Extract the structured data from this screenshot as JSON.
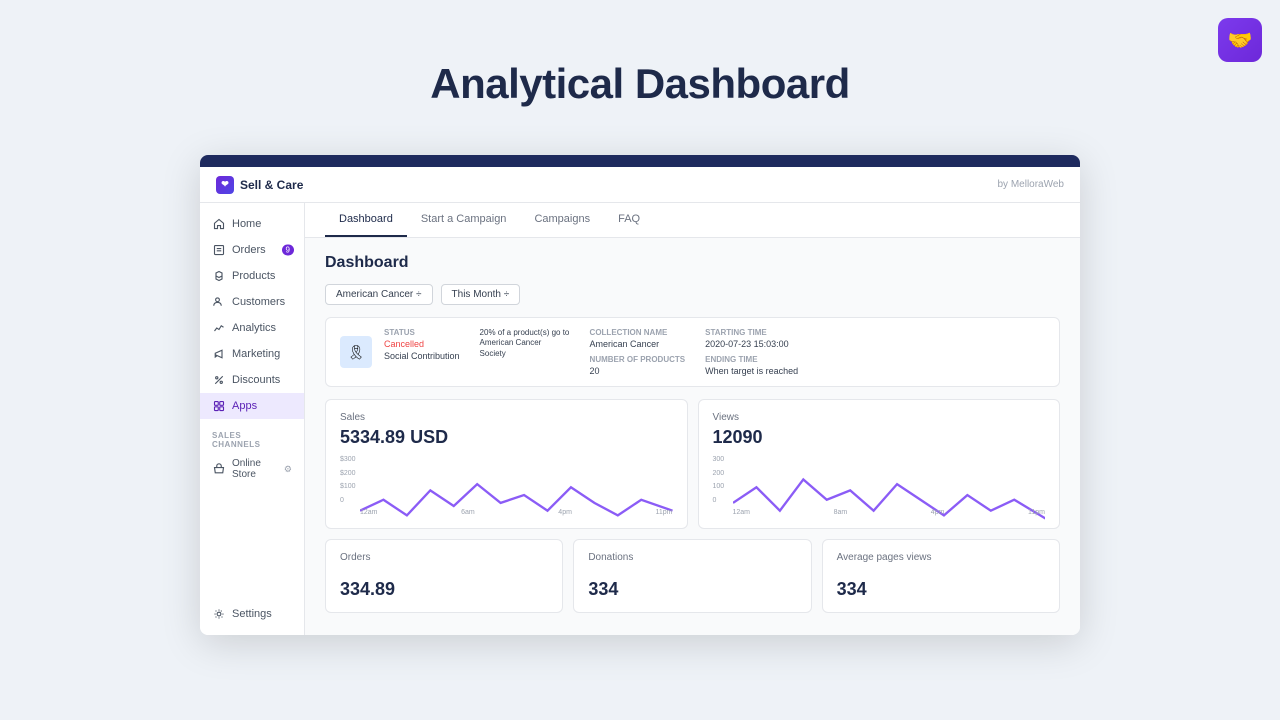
{
  "page": {
    "title": "Analytical Dashboard",
    "logo_symbol": "🤝"
  },
  "app": {
    "brand_name": "Sell & Care",
    "by_text": "by MelloraWeb"
  },
  "sidebar": {
    "nav_items": [
      {
        "id": "home",
        "label": "Home",
        "icon": "home",
        "active": false,
        "badge": null
      },
      {
        "id": "orders",
        "label": "Orders",
        "icon": "orders",
        "active": false,
        "badge": "9"
      },
      {
        "id": "products",
        "label": "Products",
        "icon": "products",
        "active": false,
        "badge": null
      },
      {
        "id": "customers",
        "label": "Customers",
        "icon": "customers",
        "active": false,
        "badge": null
      },
      {
        "id": "analytics",
        "label": "Analytics",
        "icon": "analytics",
        "active": false,
        "badge": null
      },
      {
        "id": "marketing",
        "label": "Marketing",
        "icon": "marketing",
        "active": false,
        "badge": null
      },
      {
        "id": "discounts",
        "label": "Discounts",
        "icon": "discounts",
        "active": false,
        "badge": null
      },
      {
        "id": "apps",
        "label": "Apps",
        "icon": "apps",
        "active": true,
        "badge": null
      }
    ],
    "section_title": "SALES CHANNELS",
    "sub_items": [
      {
        "id": "online-store",
        "label": "Online Store"
      }
    ],
    "bottom_items": [
      {
        "id": "settings",
        "label": "Settings",
        "icon": "settings"
      }
    ]
  },
  "tabs": [
    {
      "id": "dashboard",
      "label": "Dashboard",
      "active": true
    },
    {
      "id": "start-campaign",
      "label": "Start a Campaign",
      "active": false
    },
    {
      "id": "campaigns",
      "label": "Campaigns",
      "active": false
    },
    {
      "id": "faq",
      "label": "FAQ",
      "active": false
    }
  ],
  "dashboard": {
    "title": "Dashboard",
    "filters": {
      "campaign": "American Cancer ÷",
      "period": "This Month ÷"
    },
    "campaign_card": {
      "status_label": "Status",
      "status_value": "Cancelled",
      "status_sub": "Social Contribution",
      "description_label": "",
      "description_value": "20% of a product(s) go to American Cancer Society",
      "collection_label": "Collection name",
      "collection_value": "American Cancer",
      "number_label": "Number of products",
      "number_value": "20",
      "starting_label": "Starting time",
      "starting_value": "2020-07-23 15:03:00",
      "ending_label": "Ending time",
      "ending_value": "When target is reached"
    },
    "sales": {
      "label": "Sales",
      "value": "5334.89 USD",
      "chart_y": [
        "$300",
        "$200",
        "$100",
        "0"
      ],
      "chart_x": [
        "12am",
        "6am",
        "4pm",
        "11pm"
      ]
    },
    "views": {
      "label": "Views",
      "value": "12090",
      "chart_y": [
        "300",
        "200",
        "100",
        "0"
      ],
      "chart_x": [
        "12am",
        "8am",
        "4pm",
        "11pm"
      ]
    },
    "orders": {
      "label": "Orders",
      "value": "334.89"
    },
    "donations": {
      "label": "Donations",
      "value": "334"
    },
    "avg_page_views": {
      "label": "Average pages views",
      "value": "334"
    }
  }
}
